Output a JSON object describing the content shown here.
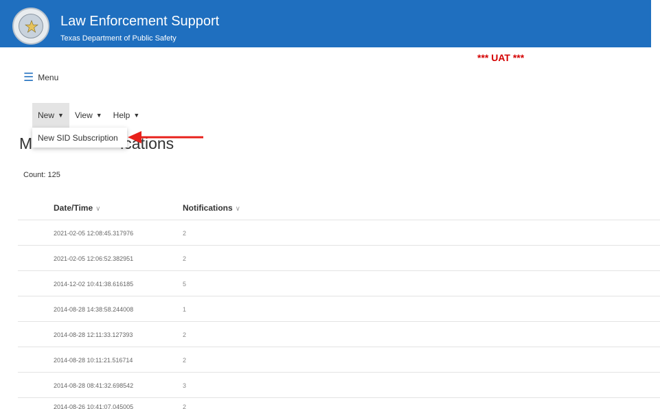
{
  "header": {
    "title": "Law Enforcement Support",
    "subtitle": "Texas Department of Public Safety",
    "logo_icon": "dps-seal-icon",
    "background_color": "#1f6fbf"
  },
  "environment_banner": {
    "text": "*** UAT ***",
    "color": "#d40000"
  },
  "menu": {
    "label": "Menu",
    "icon": "hamburger-icon"
  },
  "menubar": {
    "items": [
      {
        "label": "New",
        "icon": "chevron-down-icon"
      },
      {
        "label": "View",
        "icon": "chevron-down-icon"
      },
      {
        "label": "Help",
        "icon": "chevron-down-icon"
      }
    ],
    "dropdown": {
      "items": [
        {
          "label": "New SID Subscription"
        }
      ]
    }
  },
  "page": {
    "title_left": "M",
    "title_right": "ications",
    "count_label": "Count: 125"
  },
  "table": {
    "columns": [
      {
        "label": "Date/Time"
      },
      {
        "label": "Notifications"
      }
    ],
    "rows": [
      {
        "datetime": "2021-02-05 12:08:45.317976",
        "notifications": "2"
      },
      {
        "datetime": "2021-02-05 12:06:52.382951",
        "notifications": "2"
      },
      {
        "datetime": "2014-12-02 10:41:38.616185",
        "notifications": "5"
      },
      {
        "datetime": "2014-08-28 14:38:58.244008",
        "notifications": "1"
      },
      {
        "datetime": "2014-08-28 12:11:33.127393",
        "notifications": "2"
      },
      {
        "datetime": "2014-08-28 10:11:21.516714",
        "notifications": "2"
      },
      {
        "datetime": "2014-08-28 08:41:32.698542",
        "notifications": "3"
      },
      {
        "datetime": "2014-08-26 10:41:07.045005",
        "notifications": "2"
      }
    ]
  },
  "annotation": {
    "icon": "red-arrow-icon",
    "color": "#e8211b"
  }
}
